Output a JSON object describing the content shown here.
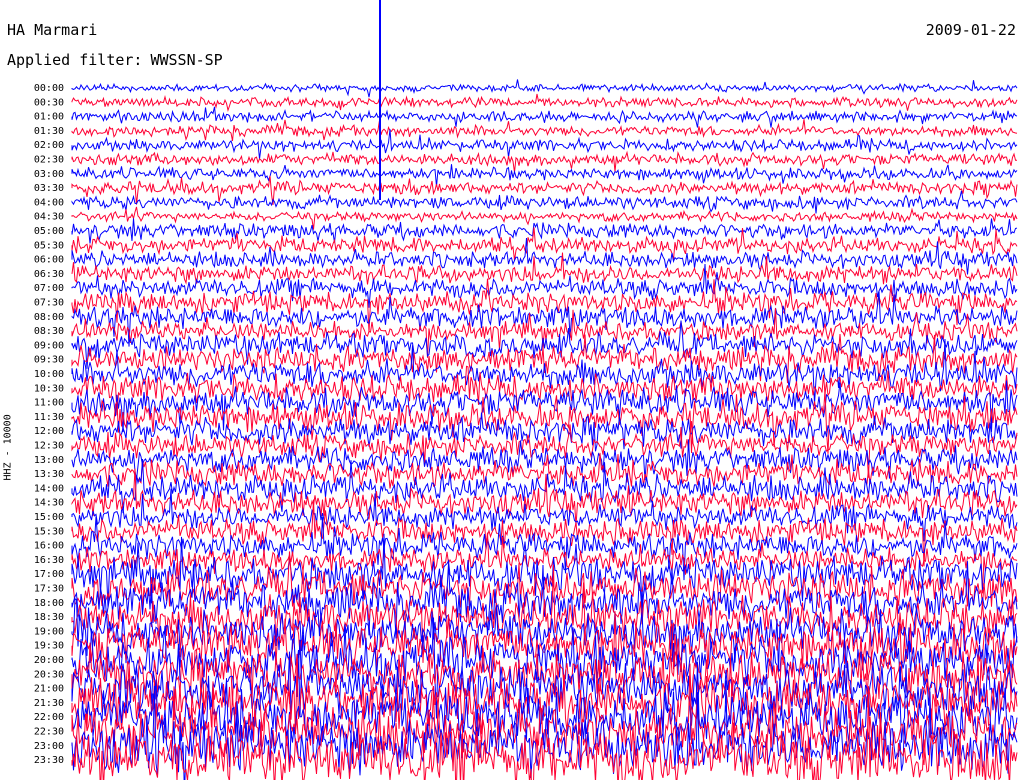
{
  "header": {
    "station": "HA Marmari",
    "date": "2009-01-22",
    "filter_label": "Applied filter:",
    "filter_value": "WWSSN-SP"
  },
  "chart_data": {
    "type": "line",
    "title": "HA Marmari",
    "ylabel": "HHZ - 10000",
    "colors": [
      "#0000ff",
      "#ff0033"
    ],
    "grid": false,
    "row_labels": [
      "00:00",
      "00:30",
      "01:00",
      "01:30",
      "02:00",
      "02:30",
      "03:00",
      "03:30",
      "04:00",
      "04:30",
      "05:00",
      "05:30",
      "06:00",
      "06:30",
      "07:00",
      "07:30",
      "08:00",
      "08:30",
      "09:00",
      "09:30",
      "10:00",
      "10:30",
      "11:00",
      "11:30",
      "12:00",
      "12:30",
      "13:00",
      "13:30",
      "14:00",
      "14:30",
      "15:00",
      "15:30",
      "16:00",
      "16:30",
      "17:00",
      "17:30",
      "18:00",
      "18:30",
      "19:00",
      "19:30",
      "20:00",
      "20:30",
      "21:00",
      "21:30",
      "22:00",
      "22:30",
      "23:00",
      "23:30"
    ],
    "relative_noise_amplitude": [
      0.6,
      0.8,
      0.9,
      0.9,
      1.0,
      1.0,
      1.0,
      1.1,
      1.1,
      0.8,
      1.3,
      1.4,
      1.4,
      1.5,
      1.6,
      1.8,
      1.9,
      1.6,
      2.0,
      2.1,
      2.2,
      2.3,
      2.3,
      2.4,
      2.3,
      2.0,
      2.1,
      2.2,
      2.3,
      2.2,
      2.0,
      2.1,
      2.2,
      2.0,
      2.8,
      3.0,
      3.2,
      3.3,
      3.4,
      3.6,
      3.8,
      3.9,
      4.0,
      4.1,
      4.3,
      4.4,
      4.6,
      4.8
    ]
  }
}
